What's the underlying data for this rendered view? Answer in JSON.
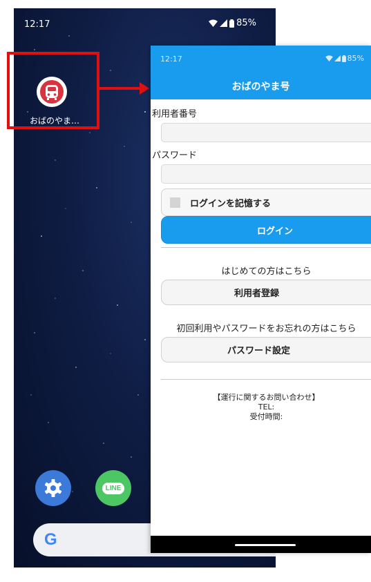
{
  "home_screen": {
    "status_time": "12:17",
    "battery": "85%",
    "app_label": "おばのやま…",
    "search_logo": "G",
    "dock": [
      {
        "name": "settings-icon"
      },
      {
        "name": "line-icon",
        "label": "LINE"
      }
    ]
  },
  "app_screen": {
    "status_time": "12:17",
    "battery": "85%",
    "title": "おばのやま号",
    "user_number_label": "利用者番号",
    "user_number_value": "",
    "password_label": "パスワード",
    "password_value": "",
    "remember_label": "ログインを記憶する",
    "login_button": "ログイン",
    "first_time_text": "はじめての方はこちら",
    "register_button": "利用者登録",
    "forgot_text": "初回利用やパスワードをお忘れの方はこちら",
    "password_setup_button": "パスワード設定",
    "contact_heading": "【運行に関するお問い合わせ】",
    "contact_tel": "TEL:",
    "contact_hours": "受付時間:"
  },
  "colors": {
    "accent": "#1a9cee",
    "highlight": "#e01010",
    "app_icon_red": "#d9333f"
  }
}
